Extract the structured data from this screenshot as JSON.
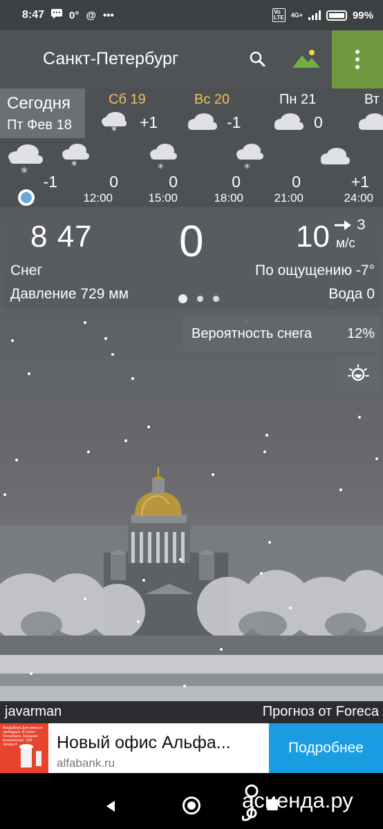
{
  "status_bar": {
    "time": "8:47",
    "notification_icons": [
      "message-icon",
      "0°",
      "at-icon",
      "more-icon"
    ],
    "temp_indicator": "0°",
    "network": "4G+",
    "volte": "Vo LTE",
    "battery": "99%"
  },
  "app_bar": {
    "city": "Санкт-Петербург",
    "icons": [
      "search-icon",
      "landscape-icon",
      "more-vertical-icon"
    ],
    "accent_color": "#6f9a3f"
  },
  "days": {
    "today": {
      "label": "Сегодня",
      "date": "Пт Фев 18"
    },
    "items": [
      {
        "name": "Сб 19",
        "temp": "+1",
        "icon": "snow-cloud-icon",
        "color": "#f0c060"
      },
      {
        "name": "Вс 20",
        "temp": "-1",
        "icon": "cloud-icon",
        "color": "#f0c060"
      },
      {
        "name": "Пн 21",
        "temp": "0",
        "icon": "cloud-icon",
        "color": "#ffffff"
      },
      {
        "name": "Вт",
        "temp": "",
        "icon": "cloud-icon",
        "color": "#ffffff"
      }
    ]
  },
  "hourly": [
    {
      "temp": "-1",
      "time": "",
      "icon": "snow-cloud-icon"
    },
    {
      "temp": "0",
      "time": "12:00",
      "icon": "snow-cloud-icon"
    },
    {
      "temp": "0",
      "time": "15:00",
      "icon": "snow-cloud-icon"
    },
    {
      "temp": "0",
      "time": "18:00",
      "icon": "snow-cloud-icon"
    },
    {
      "temp": "0",
      "time": "21:00",
      "icon": "cloud-icon"
    },
    {
      "temp": "+1",
      "time": "24:00",
      "icon": "cloud-icon"
    }
  ],
  "current": {
    "time": "8 47",
    "temp": "0",
    "wind_speed": "10",
    "wind_direction": "З",
    "wind_unit": "м/с",
    "condition": "Снег",
    "feels_like": "По ощущению -7°",
    "pressure": "Давление 729 мм",
    "water": "Вода 0"
  },
  "snow_probability": {
    "label": "Вероятность снега",
    "value": "12%"
  },
  "credits": {
    "author": "javarman",
    "provider": "Прогноз от Foreca"
  },
  "ad": {
    "title": "Новый офис Альфа...",
    "domain": "alfabank.ru",
    "cta": "Подробнее",
    "thumb_text": "АльфаБанк Для умных и свободных. В Санкт-Петербурге, Большая Конюшенная, 19/8 литера А",
    "cta_color": "#1a9ce3"
  },
  "watermark": "асиенда.ру"
}
